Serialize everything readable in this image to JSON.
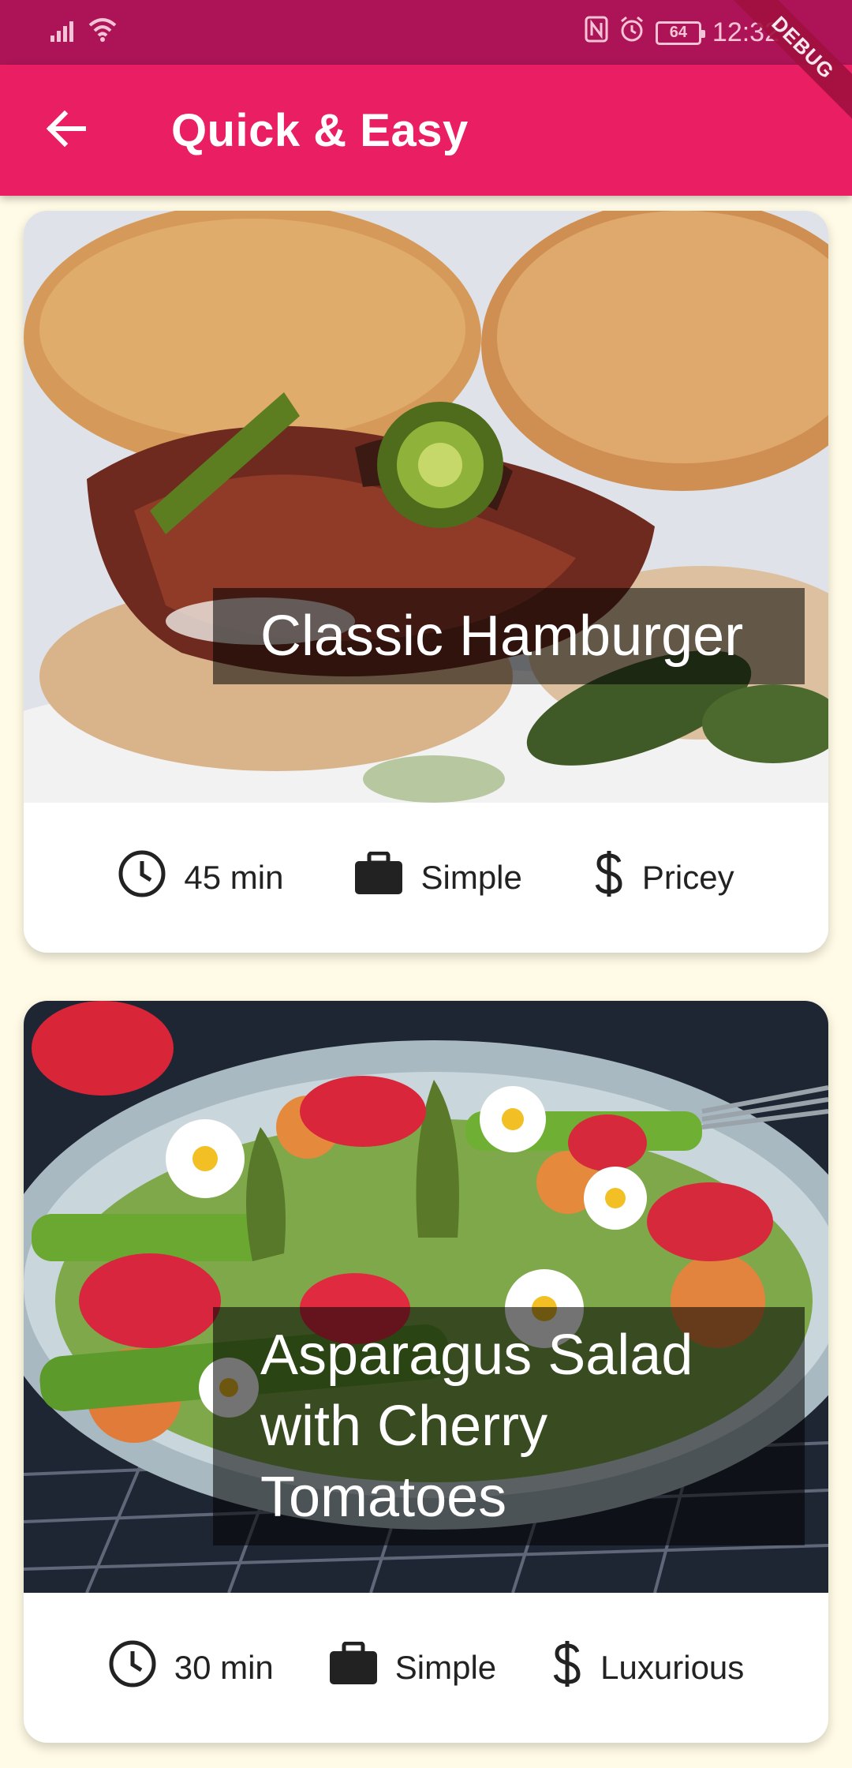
{
  "status_bar": {
    "time": "12:32",
    "battery": "64"
  },
  "debug_banner": "DEBUG",
  "app_bar": {
    "title": "Quick & Easy"
  },
  "meals": [
    {
      "title": "Classic Hamburger",
      "duration": "45 min",
      "complexity": "Simple",
      "affordability": "Pricey"
    },
    {
      "title": "Asparagus Salad with Cherry Tomatoes",
      "duration": "30 min",
      "complexity": "Simple",
      "affordability": "Luxurious"
    }
  ],
  "colors": {
    "status_bar": "#ad1457",
    "app_bar": "#e91e63",
    "background": "#fffbe6"
  }
}
